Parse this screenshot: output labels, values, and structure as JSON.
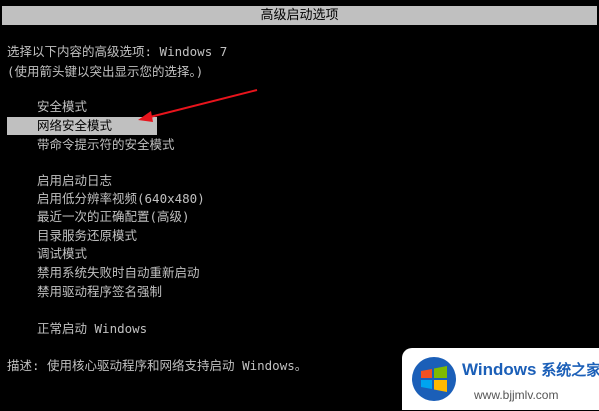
{
  "window": {
    "title": "高级启动选项"
  },
  "intro": {
    "line1": "选择以下内容的高级选项: Windows 7",
    "line2": "(使用箭头键以突出显示您的选择。)"
  },
  "menu": {
    "group1": [
      {
        "label": "安全模式"
      },
      {
        "label": "网络安全模式",
        "selected": true
      },
      {
        "label": "带命令提示符的安全模式"
      }
    ],
    "group2": [
      {
        "label": "启用启动日志"
      },
      {
        "label": "启用低分辨率视频(640x480)"
      },
      {
        "label": "最近一次的正确配置(高级)"
      },
      {
        "label": "目录服务还原模式"
      },
      {
        "label": "调试模式"
      },
      {
        "label": "禁用系统失败时自动重新启动"
      },
      {
        "label": "禁用驱动程序签名强制"
      }
    ],
    "group3": [
      {
        "label": "正常启动 Windows"
      }
    ]
  },
  "description": {
    "text": "描述: 使用核心驱动程序和网络支持启动 Windows。"
  },
  "watermark": {
    "brand": "Windows",
    "brand_cn": "系统之家",
    "url": "www.bjjmlv.com"
  },
  "colors": {
    "background": "#000000",
    "text": "#c0c0c0",
    "highlight": "#c0c0c0",
    "arrow": "#e8141c",
    "brand": "#1b5fb8"
  },
  "icons": {
    "annotation": "red-arrow-icon",
    "logo": "windows-logo-icon"
  }
}
